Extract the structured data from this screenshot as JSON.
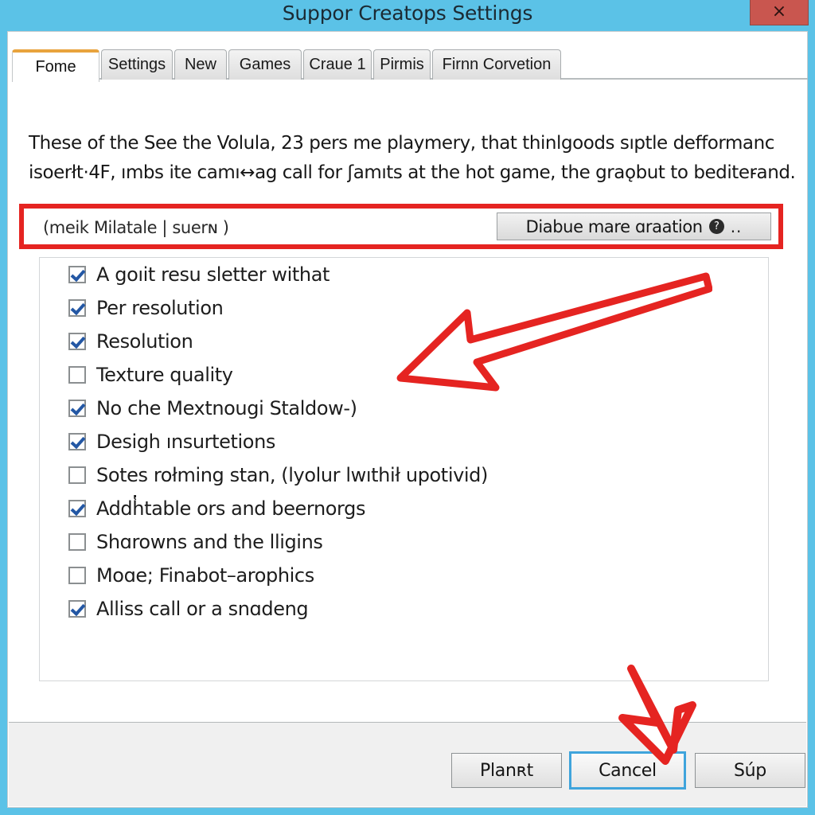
{
  "window": {
    "title": "Suppor Creatops Settings",
    "close_label": "×",
    "titlebar_color": "#5bc2e7",
    "close_color": "#c9564f"
  },
  "tabs": [
    {
      "label": "Fome",
      "active": true
    },
    {
      "label": "Settings",
      "active": false
    },
    {
      "label": "New",
      "active": false
    },
    {
      "label": "Games",
      "active": false
    },
    {
      "label": "Craue 1",
      "active": false
    },
    {
      "label": "Pirmis",
      "active": false
    },
    {
      "label": "Firnn Corvetion",
      "active": false
    }
  ],
  "description": {
    "line1": "These of the See the Volula, 23 pers me playmery, that thinlgoods sıptle defformanc",
    "line2": "isoerłt·4F, ımbs ite camı↔ag call for ʃamıts at the hot game, the graǫbut to bediter̵and."
  },
  "highlight": {
    "accent_color": "#e52421",
    "profile_label": "(meik Milatale | suerɴ )",
    "disable_button_label": "Diabue mare ɑraation",
    "help_icon": "help-circle-icon",
    "ellipsis": ".."
  },
  "options": [
    {
      "label": "A goıit resu sletter withat",
      "checked": true
    },
    {
      "label": "Per resolution",
      "checked": true
    },
    {
      "label": "Resolution",
      "checked": true
    },
    {
      "label": "Texture quality",
      "checked": false
    },
    {
      "label": "No che Mextnougi Staldow-)",
      "checked": true
    },
    {
      "label": "Desigh ınsurtetions",
      "checked": true
    },
    {
      "label": "Sotes rołming stan, (lyolur lwıthił upotivid)",
      "checked": false
    },
    {
      "label": "Addh̔table ors and beernorgs",
      "checked": true
    },
    {
      "label": "Shɑrowns and the lligins",
      "checked": false
    },
    {
      "label": "Moɑe; Finabot–arophics",
      "checked": false
    },
    {
      "label": "Alliss call or a snɑdeng",
      "checked": true
    }
  ],
  "footer": {
    "apply_label": "Planʀt",
    "cancel_label": "Cancel",
    "sup_label": "Súp",
    "focused": "cancel"
  },
  "annotations": {
    "arrow_color": "#e52421",
    "arrow_to_options": "arrow-left-icon",
    "arrow_to_cancel": "arrow-down-icon"
  }
}
